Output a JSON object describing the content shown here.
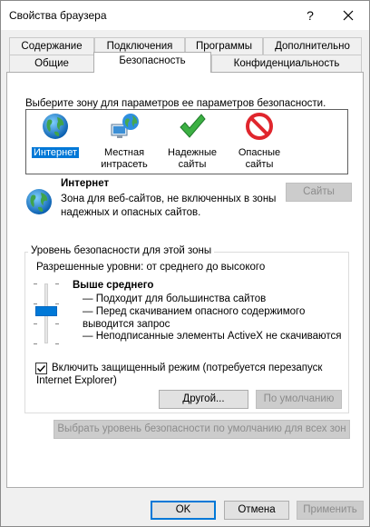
{
  "window": {
    "title": "Свойства браузера",
    "help": "?"
  },
  "tabs_back": [
    "Содержание",
    "Подключения",
    "Программы",
    "Дополнительно"
  ],
  "tabs_front": [
    "Общие",
    "Безопасность",
    "Конфиденциальность"
  ],
  "zones": {
    "prompt": "Выберите зону для параметров ее параметров безопасности.",
    "items": [
      {
        "line1": "Интернет",
        "line2": "",
        "icon": "globe-icon"
      },
      {
        "line1": "Местная",
        "line2": "интрасеть",
        "icon": "intranet-icon"
      },
      {
        "line1": "Надежные",
        "line2": "сайты",
        "icon": "checkmark-icon"
      },
      {
        "line1": "Опасные",
        "line2": "сайты",
        "icon": "restricted-icon"
      }
    ]
  },
  "zone_info": {
    "name": "Интернет",
    "description_line1": "Зона для веб-сайтов, не включенных в зоны",
    "description_line2": "надежных и опасных сайтов.",
    "sites_button": "Сайты"
  },
  "security_level": {
    "legend": "Уровень безопасности для этой зоны",
    "allowed": "Разрешенные уровни: от среднего до высокого",
    "level_name": "Выше среднего",
    "bullets": [
      "— Подходит для большинства сайтов",
      "— Перед скачиванием опасного содержимого",
      "выводится запрос",
      "— Неподписанные элементы ActiveX не скачиваются"
    ],
    "slider_level": "Выше среднего"
  },
  "protected_mode": {
    "label_line1": "Включить защищенный режим (потребуется перезапуск",
    "label_line2": "Internet Explorer)",
    "checked": true
  },
  "buttons": {
    "custom": "Другой...",
    "default": "По умолчанию",
    "reset_all": "Выбрать уровень безопасности по умолчанию для всех зон",
    "ok": "OK",
    "cancel": "Отмена",
    "apply": "Применить"
  },
  "colors": {
    "accent": "#0078d7",
    "disabled_text": "#8c8c8c"
  }
}
